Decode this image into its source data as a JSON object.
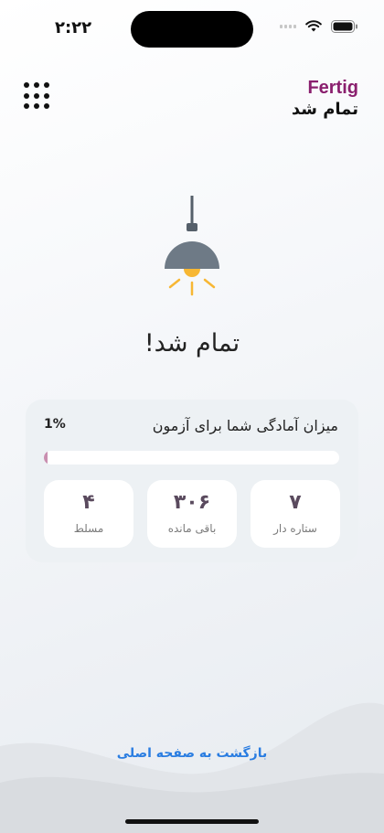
{
  "status_bar": {
    "time": "۲:۲۲"
  },
  "header": {
    "brand": "Fertig",
    "subtitle": "تمام شد"
  },
  "main": {
    "title": "تمام شد!"
  },
  "readiness": {
    "label": "میزان آمادگی شما برای آزمون",
    "percent_text": "1%",
    "progress": 0.01,
    "stats": [
      {
        "value": "۷",
        "label": "ستاره دار"
      },
      {
        "value": "۳۰۶",
        "label": "باقی مانده"
      },
      {
        "value": "۴",
        "label": "مسلط"
      }
    ]
  },
  "footer": {
    "back_label": "بازگشت به صفحه اصلی"
  },
  "colors": {
    "brand": "#8a1f6e",
    "link": "#2a7de1",
    "progress": "#c98fb0",
    "lamp_shade": "#6e7a86",
    "bulb": "#f7b733"
  },
  "icons": [
    "wifi-icon",
    "battery-icon",
    "grid-menu-icon",
    "lamp-icon"
  ]
}
